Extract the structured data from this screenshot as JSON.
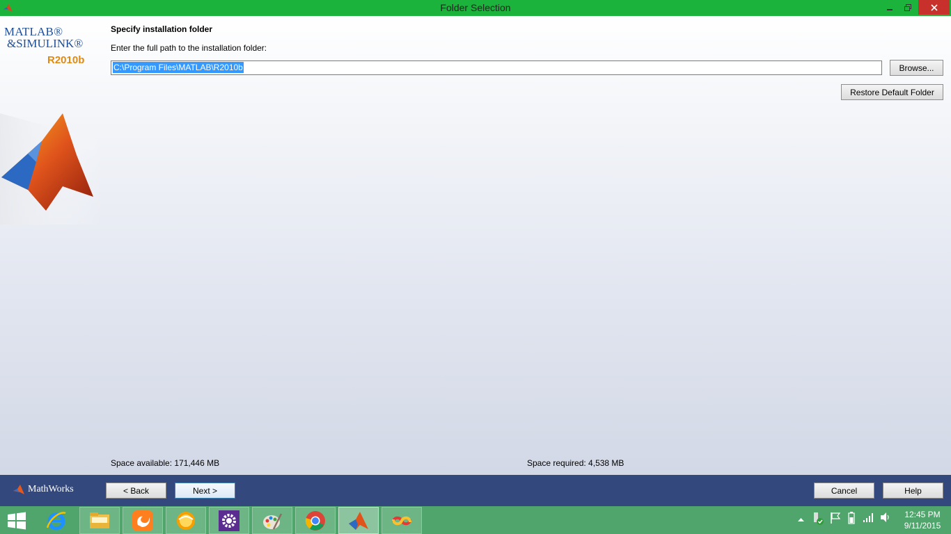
{
  "window": {
    "title": "Folder Selection"
  },
  "branding": {
    "line1": "MATLAB®",
    "line2": "&SIMULINK®",
    "release": "R2010b",
    "footer_logo": "MathWorks"
  },
  "content": {
    "heading": "Specify installation folder",
    "instruction": "Enter the full path to the installation folder:",
    "path_value": "C:\\Program Files\\MATLAB\\R2010b",
    "browse_label": "Browse...",
    "restore_label": "Restore Default Folder",
    "space_available": "Space available: 171,446 MB",
    "space_required": "Space required: 4,538 MB"
  },
  "nav": {
    "back_label": "< Back",
    "next_label": "Next >",
    "cancel_label": "Cancel",
    "help_label": "Help"
  },
  "taskbar": {
    "items": [
      "start-icon",
      "internet-explorer-icon",
      "file-explorer-icon",
      "uc-browser-icon",
      "media-player-icon",
      "settings-icon",
      "paint-icon",
      "chrome-icon",
      "matlab-icon",
      "infinity-app-icon"
    ],
    "time": "12:45 PM",
    "date": "9/11/2015"
  },
  "colors": {
    "titlebar": "#1cb33c",
    "navbar": "#33497e",
    "taskbar": "#4fa56c",
    "close_button": "#c7302b",
    "selection": "#3399ff"
  }
}
